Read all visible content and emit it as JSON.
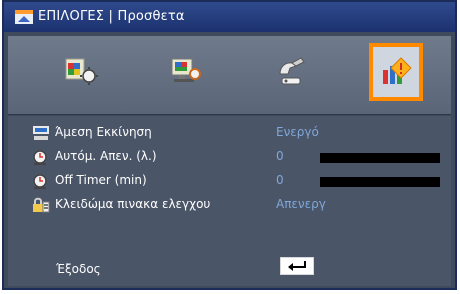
{
  "title": "ΕΠΙΛΟΓΕΣ | Προσθετα",
  "tabs": [
    {
      "icon": "picture-settings-icon",
      "active": false
    },
    {
      "icon": "display-settings-icon",
      "active": false
    },
    {
      "icon": "setup-settings-icon",
      "active": false
    },
    {
      "icon": "options-settings-icon",
      "active": true
    }
  ],
  "items": [
    {
      "icon": "direct-power-on-icon",
      "label": "Άμεση Εκκίνηση",
      "value": "Ενεργό"
    },
    {
      "icon": "auto-power-off-icon",
      "label": "Αυτόμ. Απεν. (λ.)",
      "value": "0"
    },
    {
      "icon": "off-timer-icon",
      "label": "Off Timer (min)",
      "value": "0"
    },
    {
      "icon": "keypad-lock-icon",
      "label": "Κλειδώμα πινακα ελεγχου",
      "value": "Απενεργ"
    }
  ],
  "sliders": {
    "auto_power_off": 0,
    "off_timer": 0
  },
  "exit": {
    "label": "Έξοδος"
  },
  "colors": {
    "accent": "#ff8a00",
    "title_bg": "#1c3270",
    "panel_bg": "#4a5568",
    "value_text": "#7fa7d8"
  }
}
